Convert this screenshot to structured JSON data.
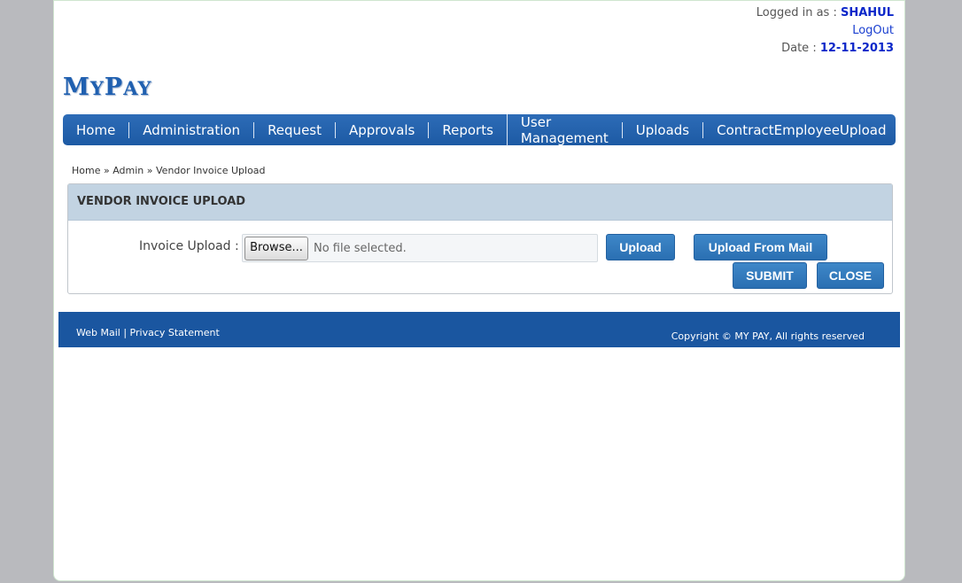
{
  "user": {
    "logged_in_label": "Logged in as :",
    "username": "SHAHUL",
    "logout": "LogOut",
    "date_label": "Date :",
    "date": "12-11-2013"
  },
  "logo": {
    "m": "M",
    "y": "Y",
    "p": "P",
    "ay": "AY"
  },
  "nav": [
    {
      "label": "Home"
    },
    {
      "label": "Administration"
    },
    {
      "label": "Request"
    },
    {
      "label": "Approvals"
    },
    {
      "label": "Reports"
    },
    {
      "label": "User Management"
    },
    {
      "label": "Uploads"
    },
    {
      "label": "ContractEmployeeUpload"
    }
  ],
  "breadcrumb": {
    "home": "Home",
    "sep": "»",
    "admin": "Admin",
    "current": "Vendor Invoice Upload"
  },
  "panel": {
    "title": "VENDOR INVOICE UPLOAD",
    "field_label": "Invoice Upload :",
    "browse": "Browse...",
    "file_status": "No file selected.",
    "upload": "Upload",
    "upload_mail": "Upload From Mail",
    "submit": "SUBMIT",
    "close": "CLOSE"
  },
  "footer": {
    "webmail": "Web Mail",
    "divider": "|",
    "privacy": "Privacy Statement",
    "copyright": "Copyright © MY PAY, All rights reserved"
  },
  "colors": {
    "nav_bg": "#1d5aa4",
    "accent_text": "#0b27c9",
    "footer_bg": "#1a56a0",
    "panel_head": "#c2d3e2"
  }
}
